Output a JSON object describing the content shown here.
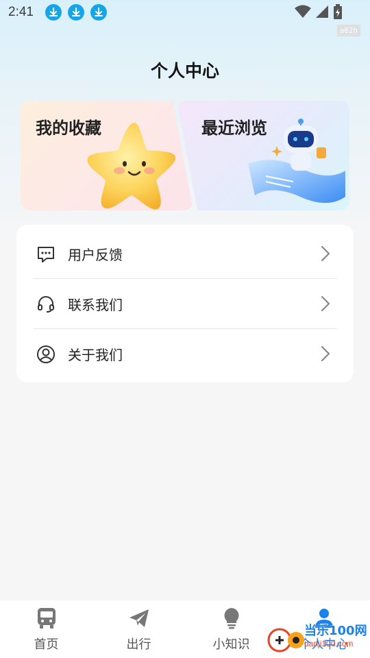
{
  "status_bar": {
    "time": "2:41",
    "build_tag": "a82h"
  },
  "header": {
    "title": "个人中心"
  },
  "cards": {
    "favorites": {
      "label": "我的收藏"
    },
    "recent": {
      "label": "最近浏览"
    }
  },
  "menu": {
    "items": [
      {
        "label": "用户反馈",
        "icon": "feedback-icon"
      },
      {
        "label": "联系我们",
        "icon": "headset-icon"
      },
      {
        "label": "关于我们",
        "icon": "user-circle-icon"
      }
    ]
  },
  "tabbar": {
    "tabs": [
      {
        "label": "首页",
        "icon": "bus-icon"
      },
      {
        "label": "出行",
        "icon": "paper-plane-icon"
      },
      {
        "label": "小知识",
        "icon": "lightbulb-icon"
      },
      {
        "label": "个人中心",
        "icon": "person-icon",
        "active": true
      }
    ],
    "active_color": "#1a82e8"
  },
  "watermark": {
    "text": "当乐100网",
    "url_text": "danji100.com"
  }
}
